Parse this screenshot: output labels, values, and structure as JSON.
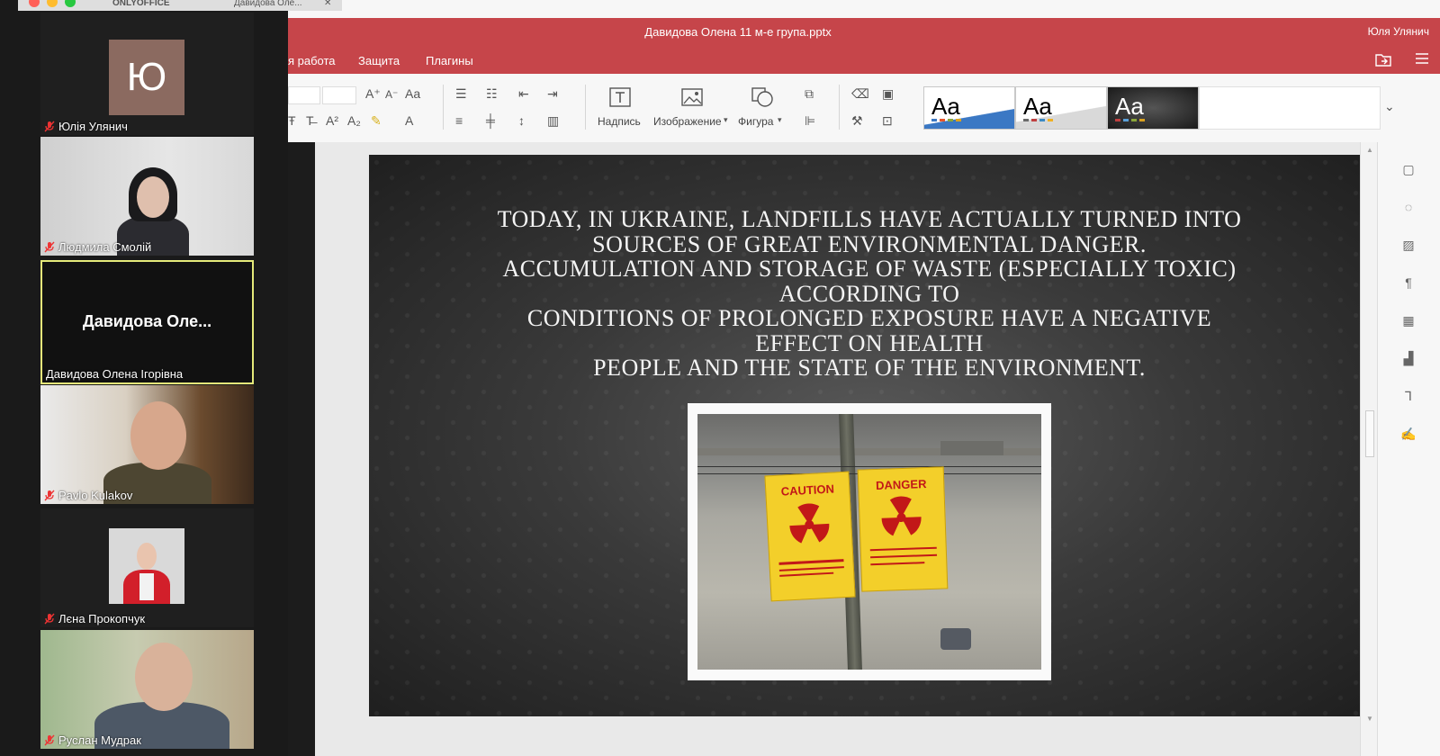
{
  "browser": {
    "tab1_label": "ONLYOFFICE",
    "tab2_label": "Давидова Оле...",
    "tab2_close": "✕"
  },
  "participants": [
    {
      "name": "Юлія Улянич",
      "avatar_letter": "Ю",
      "muted": true
    },
    {
      "name": "Людмила Смолій",
      "muted": true
    },
    {
      "name": "Давидова Олена Ігорівна",
      "display_title": "Давидова Оле...",
      "active_speaker": true
    },
    {
      "name": "Pavlo Kulakov",
      "muted": true
    },
    {
      "name": "Лєна Прокопчук",
      "muted": true
    },
    {
      "name": "Руслан Мудрак",
      "muted": true
    }
  ],
  "editor": {
    "document_title": "Давидова Олена 11 м-е група.pptx",
    "user_name": "Юля Улянич",
    "menu_tabs": [
      "я работа",
      "Защита",
      "Плагины"
    ],
    "toolbar": {
      "textbox_label": "Надпись",
      "image_label": "Изображение",
      "shape_label": "Фигура",
      "theme_sample": "Aa"
    },
    "colors": {
      "header": "#c6454a",
      "active_speaker_border": "#e5ea7a"
    }
  },
  "slide": {
    "text_lines": [
      "Today, in Ukraine, landfills have actually turned into",
      "sources of great environmental danger.",
      "Accumulation and storage of waste (especially toxic)",
      "according to",
      "conditions of prolonged exposure have a negative",
      "effect on health",
      "people and the state of the environment."
    ],
    "image": {
      "sign_left": "CAUTION",
      "sign_right": "DANGER"
    }
  }
}
